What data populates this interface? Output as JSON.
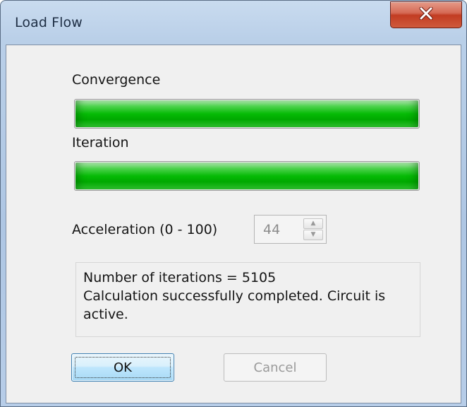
{
  "window": {
    "title": "Load Flow",
    "close_glyph": "X"
  },
  "convergence": {
    "label": "Convergence",
    "progress": 1.0
  },
  "iteration": {
    "label": "Iteration",
    "progress": 1.0
  },
  "acceleration": {
    "label": "Acceleration (0 - 100)",
    "value": "44",
    "up_glyph": "▲",
    "down_glyph": "▼"
  },
  "status": {
    "line1": "Number of iterations = 5105",
    "line2": "Calculation successfully completed. Circuit is active."
  },
  "buttons": {
    "ok": "OK",
    "cancel": "Cancel"
  },
  "colors": {
    "progress_green": "#06bb06",
    "close_red": "#c23c22",
    "title_bar": "#b9cfe8"
  },
  "icons": {
    "close": "close-icon"
  }
}
